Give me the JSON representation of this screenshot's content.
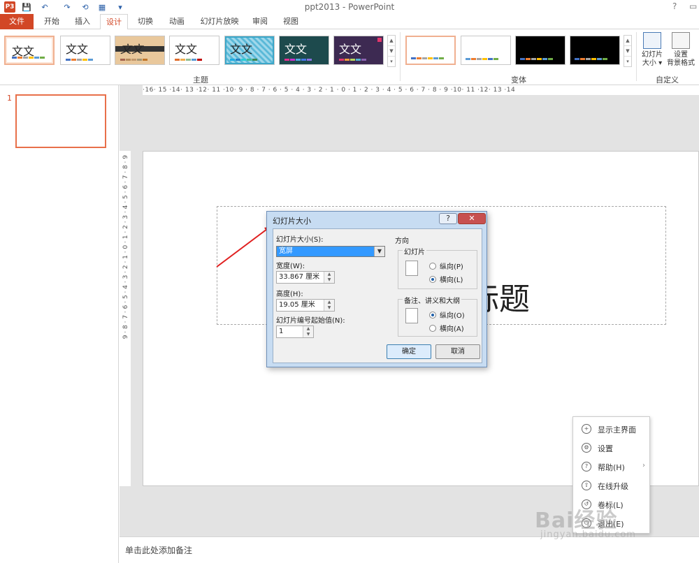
{
  "window": {
    "title": "ppt2013 - PowerPoint",
    "help": "?"
  },
  "qat": {
    "app": "P3",
    "save": "💾",
    "undo": "↶",
    "redo": "↷",
    "extra1": "⟲",
    "extra2": "▦",
    "extra3": "▾"
  },
  "tabs": [
    "文件",
    "开始",
    "插入",
    "设计",
    "切换",
    "动画",
    "幻灯片放映",
    "审阅",
    "视图"
  ],
  "ribbon": {
    "theme_text": "文文",
    "group_themes": "主题",
    "group_variants": "变体",
    "group_customize": "自定义",
    "slide_size_label": "幻灯片",
    "slide_size_label2": "大小 ▾",
    "bg_format_label": "设置",
    "bg_format_label2": "背景格式"
  },
  "ruler": {
    "horizontal": "·16· 15 ·14· 13 ·12· 11 ·10· 9 · 8 · 7 · 6 · 5 · 4 · 3 · 2 · 1 · 0 · 1 · 2 · 3 · 4 · 5 · 6 · 7 · 8 · 9 ·10· 11 ·12· 13 ·14"
  },
  "thumbnails": {
    "slide_number": "1"
  },
  "slide": {
    "title": "加标题"
  },
  "notes": {
    "placeholder": "单击此处添加备注"
  },
  "dialog": {
    "title": "幻灯片大小",
    "size_label": "幻灯片大小(S):",
    "size_value": "宽屏",
    "width_label": "宽度(W):",
    "width_value": "33.867 厘米",
    "height_label": "高度(H):",
    "height_value": "19.05 厘米",
    "numbering_label": "幻灯片编号起始值(N):",
    "numbering_value": "1",
    "orientation_label": "方向",
    "slides_group": "幻灯片",
    "slides_portrait": "纵向(P)",
    "slides_landscape": "横向(L)",
    "notes_group": "备注、讲义和大纲",
    "notes_portrait": "纵向(O)",
    "notes_landscape": "横向(A)",
    "ok": "确定",
    "cancel": "取消",
    "close": "✕"
  },
  "context_menu": {
    "items": [
      {
        "icon": "+",
        "label": "显示主界面"
      },
      {
        "icon": "⚙",
        "label": "设置"
      },
      {
        "icon": "?",
        "label": "帮助(H)"
      },
      {
        "icon": "⇧",
        "label": "在线升级"
      },
      {
        "icon": "↺",
        "label": "卷标(L)"
      },
      {
        "icon": "⏻",
        "label": "退出(E)"
      }
    ]
  },
  "watermark": {
    "brand": "Bai经验",
    "url": "jingyan.baidu.com"
  },
  "colors": {
    "accent": "#d24726",
    "dialog_frame": "#c7dcf2",
    "selection": "#3399ff"
  }
}
